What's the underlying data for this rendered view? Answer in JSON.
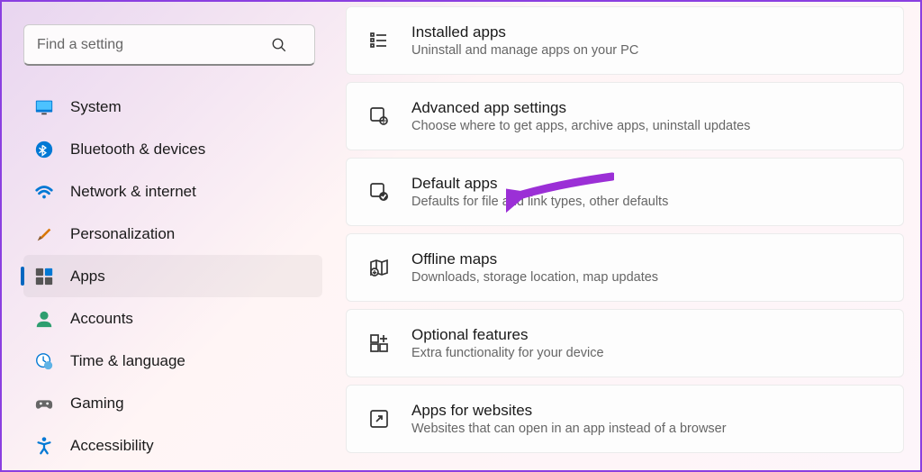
{
  "search": {
    "placeholder": "Find a setting"
  },
  "sidebar": {
    "items": [
      {
        "label": "System"
      },
      {
        "label": "Bluetooth & devices"
      },
      {
        "label": "Network & internet"
      },
      {
        "label": "Personalization"
      },
      {
        "label": "Apps"
      },
      {
        "label": "Accounts"
      },
      {
        "label": "Time & language"
      },
      {
        "label": "Gaming"
      },
      {
        "label": "Accessibility"
      }
    ]
  },
  "cards": [
    {
      "title": "Installed apps",
      "desc": "Uninstall and manage apps on your PC"
    },
    {
      "title": "Advanced app settings",
      "desc": "Choose where to get apps, archive apps, uninstall updates"
    },
    {
      "title": "Default apps",
      "desc": "Defaults for file and link types, other defaults"
    },
    {
      "title": "Offline maps",
      "desc": "Downloads, storage location, map updates"
    },
    {
      "title": "Optional features",
      "desc": "Extra functionality for your device"
    },
    {
      "title": "Apps for websites",
      "desc": "Websites that can open in an app instead of a browser"
    }
  ]
}
